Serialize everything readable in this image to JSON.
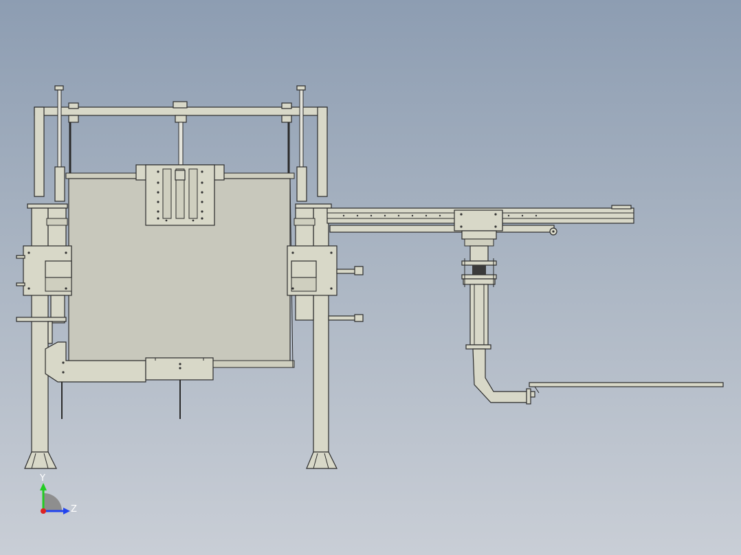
{
  "triad": {
    "y_label": "Y",
    "z_label": "Z",
    "colors": {
      "y": "#22cc22",
      "z": "#2244ee",
      "x": "#dd2222"
    }
  },
  "colors": {
    "background_top": "#8d9db2",
    "background_bottom": "#c9ced6",
    "part_fill": "#d8d8c8",
    "edge": "#2a2a2a"
  }
}
